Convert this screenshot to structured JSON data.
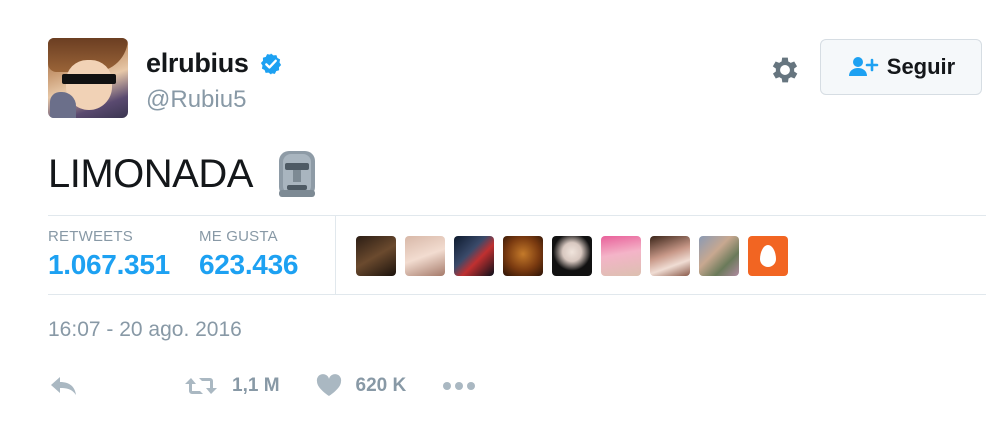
{
  "user": {
    "display_name": "elrubius",
    "handle": "@Rubiu5",
    "verified": true
  },
  "follow_button": {
    "label": "Seguir"
  },
  "tweet": {
    "text": "LIMONADA",
    "emoji": "moai"
  },
  "stats": {
    "retweets_label": "RETWEETS",
    "retweets_value": "1.067.351",
    "likes_label": "ME GUSTA",
    "likes_value": "623.436"
  },
  "likers": [
    {
      "avatar": "liker-1"
    },
    {
      "avatar": "liker-2"
    },
    {
      "avatar": "liker-3"
    },
    {
      "avatar": "liker-4"
    },
    {
      "avatar": "liker-5"
    },
    {
      "avatar": "liker-6"
    },
    {
      "avatar": "liker-7"
    },
    {
      "avatar": "liker-8"
    },
    {
      "avatar": "liker-9-default-egg"
    }
  ],
  "timestamp": "16:07 - 20 ago. 2016",
  "actions": {
    "retweet_count": "1,1 M",
    "like_count": "620 K"
  },
  "colors": {
    "accent": "#1da1f2",
    "muted": "#8899a6",
    "text": "#14171a",
    "border": "#e1e8ed",
    "egg": "#f26522"
  }
}
